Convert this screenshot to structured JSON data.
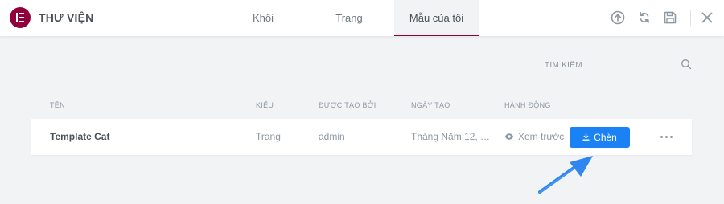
{
  "header": {
    "title": "THƯ VIỆN",
    "tabs": [
      "Khối",
      "Trang",
      "Mẫu của tôi"
    ],
    "active_tab": "Mẫu của tôi",
    "icons": [
      "upload-icon",
      "sync-icon",
      "save-icon",
      "close-icon"
    ]
  },
  "search": {
    "placeholder": "TÌM KIẾM",
    "value": ""
  },
  "table": {
    "columns": [
      "TÊN",
      "KIỂU",
      "ĐƯỢC TẠO BỞI",
      "NGÀY TẠO",
      "HÀNH ĐỘNG"
    ],
    "rows": [
      {
        "name": "Template Cat",
        "type": "Trang",
        "author": "admin",
        "date": "Tháng Năm 12, 20...",
        "preview_label": "Xem trước",
        "insert_label": "Chèn"
      }
    ]
  },
  "colors": {
    "brand": "#92003b",
    "primary_button": "#1a82f5",
    "background": "#f1f3f5",
    "annotation_arrow": "#2f86f0"
  }
}
